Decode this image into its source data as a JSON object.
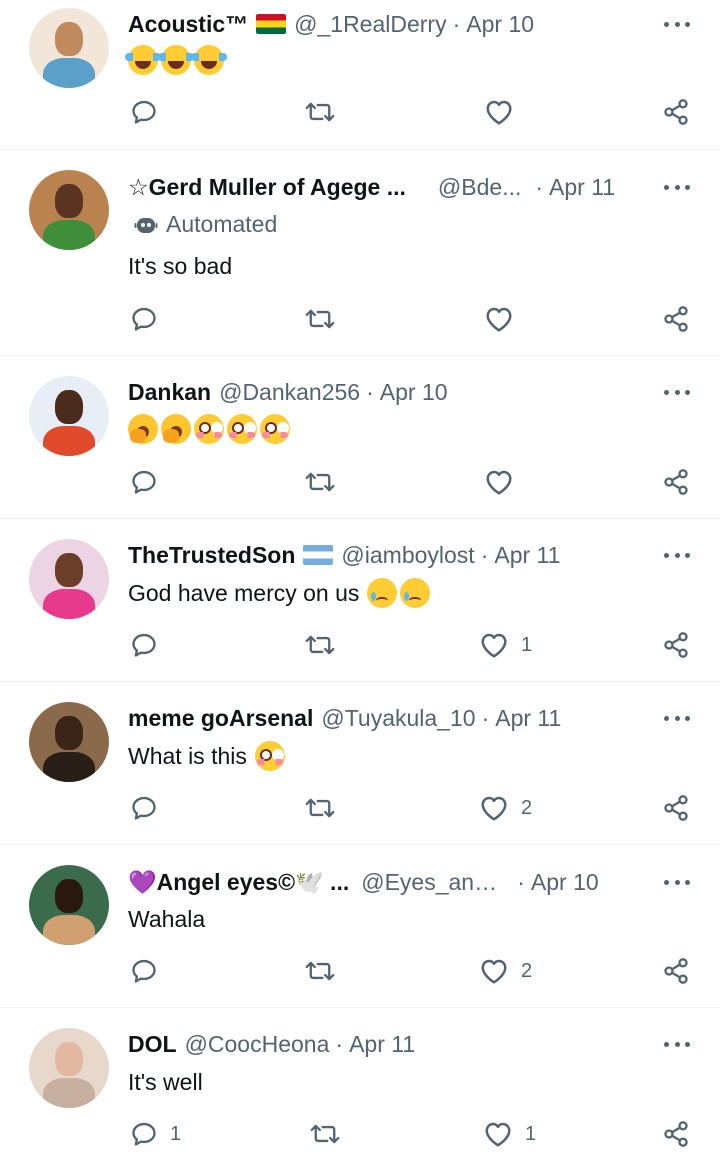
{
  "tweets": [
    {
      "name": "Acoustic™",
      "handle": "@_1RealDerry",
      "separator": "·",
      "date": "Apr 10",
      "text": "",
      "emojis": [
        "face-with-tears-of-joy",
        "face-with-tears-of-joy",
        "face-with-tears-of-joy"
      ],
      "badge": "ghana-flag",
      "automated": "",
      "replies": "",
      "likes": ""
    },
    {
      "name": "☆Gerd Muller of Agege ...",
      "handle": "@Bde...",
      "separator": "·",
      "date": "Apr 11",
      "text": "It's so bad",
      "emojis": [],
      "badge": "",
      "automated": "Automated",
      "replies": "",
      "likes": ""
    },
    {
      "name": "Dankan",
      "handle": "@Dankan256",
      "separator": "·",
      "date": "Apr 10",
      "text": "",
      "emojis": [
        "yawning-face",
        "yawning-face",
        "flushed-face",
        "flushed-face",
        "flushed-face"
      ],
      "badge": "",
      "automated": "",
      "replies": "",
      "likes": ""
    },
    {
      "name": "TheTrustedSon",
      "handle": "@iamboylost",
      "separator": "·",
      "date": "Apr 11",
      "text": "God have mercy on us",
      "emojis": [
        "crying-face",
        "crying-face"
      ],
      "badge": "argentina-flag",
      "automated": "",
      "replies": "",
      "likes": "1"
    },
    {
      "name": "meme goArsenal",
      "handle": "@Tuyakula_10",
      "separator": "·",
      "date": "Apr 11",
      "text": "What is this",
      "emojis": [
        "flushed-face"
      ],
      "badge": "",
      "automated": "",
      "replies": "",
      "likes": "2"
    },
    {
      "name": "💜Angel eyes©🕊️ ...",
      "handle": "@Eyes_ang...",
      "separator": "·",
      "date": "Apr 10",
      "text": "Wahala",
      "emojis": [],
      "badge": "",
      "automated": "",
      "replies": "",
      "likes": "2"
    },
    {
      "name": "DOL",
      "handle": "@CoocHeona",
      "separator": "·",
      "date": "Apr 11",
      "text": "It's well",
      "emojis": [],
      "badge": "",
      "automated": "",
      "replies": "1",
      "likes": "1"
    }
  ],
  "icons": {
    "reply": "reply-icon",
    "retweet": "retweet-icon",
    "like": "heart-icon",
    "share": "share-icon",
    "more": "more-options-icon",
    "automated": "robot-icon"
  },
  "colors": {
    "text": "#0f1419",
    "secondary": "#536471",
    "divider": "#eff3f4"
  }
}
